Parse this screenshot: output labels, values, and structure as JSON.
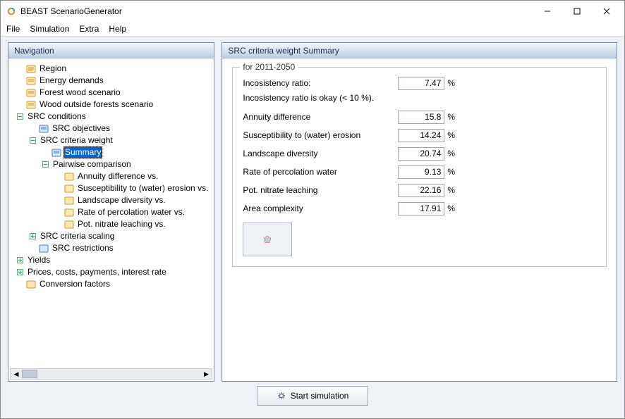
{
  "window": {
    "title": "BEAST ScenarioGenerator"
  },
  "menus": {
    "file": "File",
    "simulation": "Simulation",
    "extra": "Extra",
    "help": "Help"
  },
  "panelLeft": {
    "title": "Navigation"
  },
  "panelRight": {
    "title": "SRC criteria weight Summary"
  },
  "tree": {
    "region": "Region",
    "energyDemands": "Energy demands",
    "forestWood": "Forest wood scenario",
    "woodOutside": "Wood outside forests scenario",
    "srcConditions": "SRC conditions",
    "srcObjectives": "SRC objectives",
    "srcCriteriaWeight": "SRC criteria weight",
    "summary": "Summary",
    "pairwise": "Pairwise comparison",
    "annuityVs": "Annuity difference vs.",
    "susceptVs": "Susceptibility to (water) erosion vs.",
    "landscapeVs": "Landscape diversity vs.",
    "percolationVs": "Rate of percolation water vs.",
    "nitrateVs": "Pot. nitrate leaching vs.",
    "srcCriteriaScaling": "SRC criteria scaling",
    "srcRestrictions": "SRC restrictions",
    "yields": "Yields",
    "prices": "Prices, costs, payments, interest rate",
    "conversion": "Conversion factors"
  },
  "form": {
    "legend": "for 2011-2050",
    "incRatioLabel": "Incosistency ratio:",
    "incRatioValue": "7.47",
    "incHint": "Incosistency ratio is okay (< 10 %).",
    "annuityLabel": "Annuity difference",
    "annuityValue": "15.8",
    "susceptLabel": "Susceptibility to (water) erosion",
    "susceptValue": "14.24",
    "landscapeLabel": "Landscape diversity",
    "landscapeValue": "20.74",
    "percolationLabel": "Rate of percolation water",
    "percolationValue": "9.13",
    "nitrateLabel": "Pot. nitrate leaching",
    "nitrateValue": "22.16",
    "areaLabel": "Area complexity",
    "areaValue": "17.91",
    "unit": "%"
  },
  "actions": {
    "start": "Start simulation"
  }
}
